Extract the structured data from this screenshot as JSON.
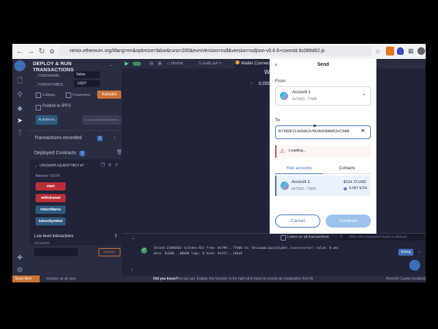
{
  "browser": {
    "url": "remix.ethereum.org/#lang=en&optimize=false&runs=200&evmVersion=null&version=soljson-v0.6.6+commit.6c089d02.js"
  },
  "sidebar": {
    "title_line1": "DEPLOY & RUN",
    "title_line2": "TRANSACTIONS",
    "token_name_label": "_TOKENNAME:",
    "token_name_value": "Tether",
    "token_symbol_label": "_TOKENSYMBOL:",
    "token_symbol_value": "USDT",
    "calldata_label": "Calldata",
    "parameters_label": "Parameters",
    "transact_label": "transact",
    "publish_ipfs": "Publish to IPFS",
    "at_address_label": "At Address",
    "load_contract_placeholder": "Load contract from Address",
    "transactions_recorded": "Transactions recorded",
    "transactions_count": "1",
    "deployed_contracts": "Deployed Contracts",
    "deployed_count": "1",
    "contract_name": "UNISWAPLIQUIDITYBOT AT",
    "balance": "Balance: 0 ETH",
    "functions": [
      {
        "label": "start",
        "color": "#b82f3a"
      },
      {
        "label": "withdrawal",
        "color": "#b82f3a"
      },
      {
        "label": "tokenName",
        "color": "#2f5b7c"
      },
      {
        "label": "tokenSymbol",
        "color": "#2f5b7c"
      }
    ],
    "low_level": "Low level interactions",
    "calldata_caption": "CALLDATA",
    "transact_small": "Transact"
  },
  "tabs": [
    {
      "label": "Home"
    },
    {
      "label": "usdt.sol"
    },
    {
      "label": "Wallet Connect"
    }
  ],
  "main": {
    "wallet_heading": "Wallet",
    "balance_value": "0.000"
  },
  "terminal": {
    "listen_label": "Listen on all transactions",
    "filter_placeholder": "Filter with transaction hash or address",
    "log_line1": "[block:21886682 txIndex:93] from: 0x799...77b06 to: UniswapLiquidityBot.(constructor) value: 0 wei",
    "log_line2": "data: 0x608...00000 logs: 0 hash: 0x217...2d6a9",
    "debug_label": "Debug"
  },
  "statusbar": {
    "scam_alert": "Scam Alert",
    "git_text": "Initialize as git repo",
    "did_you_know": "Did you know?",
    "tip": "You can use 'Explain this function' in the right-click menu to receive an explanation from AI.",
    "copilot": "RemixAI Copilot (enabled)"
  },
  "modal": {
    "title": "Send",
    "from_label": "From",
    "from_account_name": "Account 1",
    "from_account_addr": "0x7991f...77b06",
    "to_label": "To",
    "to_value": "B7383F113d3dE2cf9c0b50b8d63cC9A8",
    "loading_text": "Loading...",
    "tab_your_accounts": "Your accounts",
    "tab_contacts": "Contacts",
    "account_name": "Account 1",
    "account_addr": "0x7991f...77b06",
    "account_usd": "$154.73 USD",
    "account_eth": "0.057 ETH",
    "cancel_label": "Cancel",
    "continue_label": "Continue"
  }
}
